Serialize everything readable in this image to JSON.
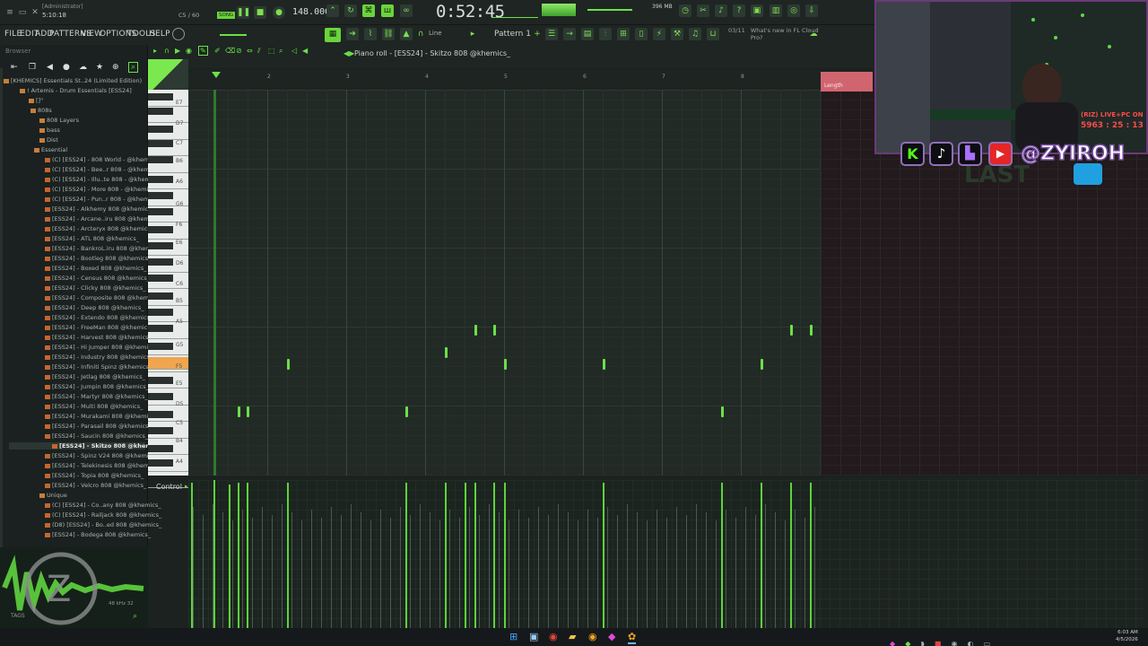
{
  "titlebar": {
    "user": "[Administrator]",
    "position": "5:10:18",
    "cpu": "C5 / 60",
    "song_mode_label": "SONG",
    "bpm": "148.000",
    "time": "0:52:45",
    "memory": "396 MB"
  },
  "menu": [
    "FILE",
    "EDIT",
    "ADD",
    "PATTERNS",
    "VIEW",
    "OPTIONS",
    "TOOLS",
    "HELP"
  ],
  "toolbar": {
    "snap_label": "Line",
    "pattern": "Pattern 1",
    "hint_date": "03/11",
    "hint_text": "What's new in FL Cloud Pro?"
  },
  "browser": {
    "title": "Browser",
    "items": [
      "[KHEMICS] Essentials St..24 (Limited Edition)",
      "! Artemis - Drum Essentials [ESS24]",
      "[]\"",
      "808s",
      "808 Layers",
      "bass",
      "Dist",
      "Essential",
      "(C) [ESS24] - 808 World - @khemics_",
      "(C) [ESS24] - Bee..r 808 - @khemics_",
      "(C) [ESS24] - Illu..te 808 - @khemics_",
      "(C) [ESS24] - More 808 - @khemics_",
      "(C) [ESS24] - Pun..r 808 - @khemics_",
      "[ESS24] - Alkhemy 808 @khemics_",
      "[ESS24] - Arcane..iru 808 @khemics_",
      "[ESS24] - Arcteryx 808 @khemics_",
      "[ESS24] - ATL 808 @khemics_",
      "[ESS24] - BankroL.iru 808 @khemics_",
      "[ESS24] - Bootleg 808 @khemics_",
      "[ESS24] - Boxed 808 @khemics_",
      "[ESS24] - Census 808 @khemics_",
      "[ESS24] - Clicky 808 @khemics_",
      "[ESS24] - Composite 808 @khemics_",
      "[ESS24] - Deep 808 @khemics_",
      "[ESS24] - Extendo 808 @khemics_",
      "[ESS24] - FreeMan 808 @khemics_",
      "[ESS24] - Harvest 808 @khemics_",
      "[ESS24] - Hi Jumper 808 @khemics_",
      "[ESS24] - Industry 808 @khemics_",
      "[ESS24] - Infiniti Spinz @khemics_",
      "[ESS24] - Jetlag 808 @khemics_",
      "[ESS24] - Jumpin 808 @khemics_",
      "[ESS24] - Martyr 808 @khemics_",
      "[ESS24] - Multi 808 @khemics_",
      "[ESS24] - Murakami 808 @khemics_",
      "[ESS24] - Parasail 808 @khemics_",
      "[ESS24] - Saucin 808 @khemics_",
      "[ESS24] - Skitzo 808 @khemics_",
      "[ESS24] - Spinz V24 808 @khemics_",
      "[ESS24] - Telekinesis 808 @khemics_",
      "[ESS24] - Topia 808 @khemics_",
      "[ESS24] - Velcro 808 @khemics_",
      "Unique",
      "(C) [ESS24] - Co..any 808 @khemics_",
      "(C) [ESS24] - Railjack 808 @khemics_",
      "(D8) [ESS24] - Bo..ed 808 @khemics_",
      "[ESS24] - Bodega 808 @khemics_"
    ],
    "selected_index": 37,
    "sample_rate": "48 kHz 32",
    "tags_label": "TAGS"
  },
  "piano_roll": {
    "title": "Piano roll - [ESS24] - Skitzo 808 @khemics_",
    "control_label": "Control",
    "length_label": "Length",
    "bar_numbers": [
      "2",
      "3",
      "4",
      "5",
      "6",
      "7",
      "8"
    ],
    "key_labels": [
      "E7",
      "D7",
      "C7",
      "B6",
      "A6",
      "G6",
      "F6",
      "E6",
      "D6",
      "C6",
      "B5",
      "A5",
      "G5",
      "F5",
      "E5",
      "D5",
      "C5",
      "B4",
      "A4"
    ]
  },
  "overlay": {
    "handle": "@ZYIROH",
    "live_text": "(RIZ) LIVE+PC ON",
    "live_timer": "5963 : 25 : 13"
  },
  "taskbar": {
    "time": "6:03 AM",
    "date": "4/5/2026"
  },
  "colors": {
    "accent": "#6be04a",
    "background": "#222a26",
    "overlay_border": "#6b3a78"
  }
}
